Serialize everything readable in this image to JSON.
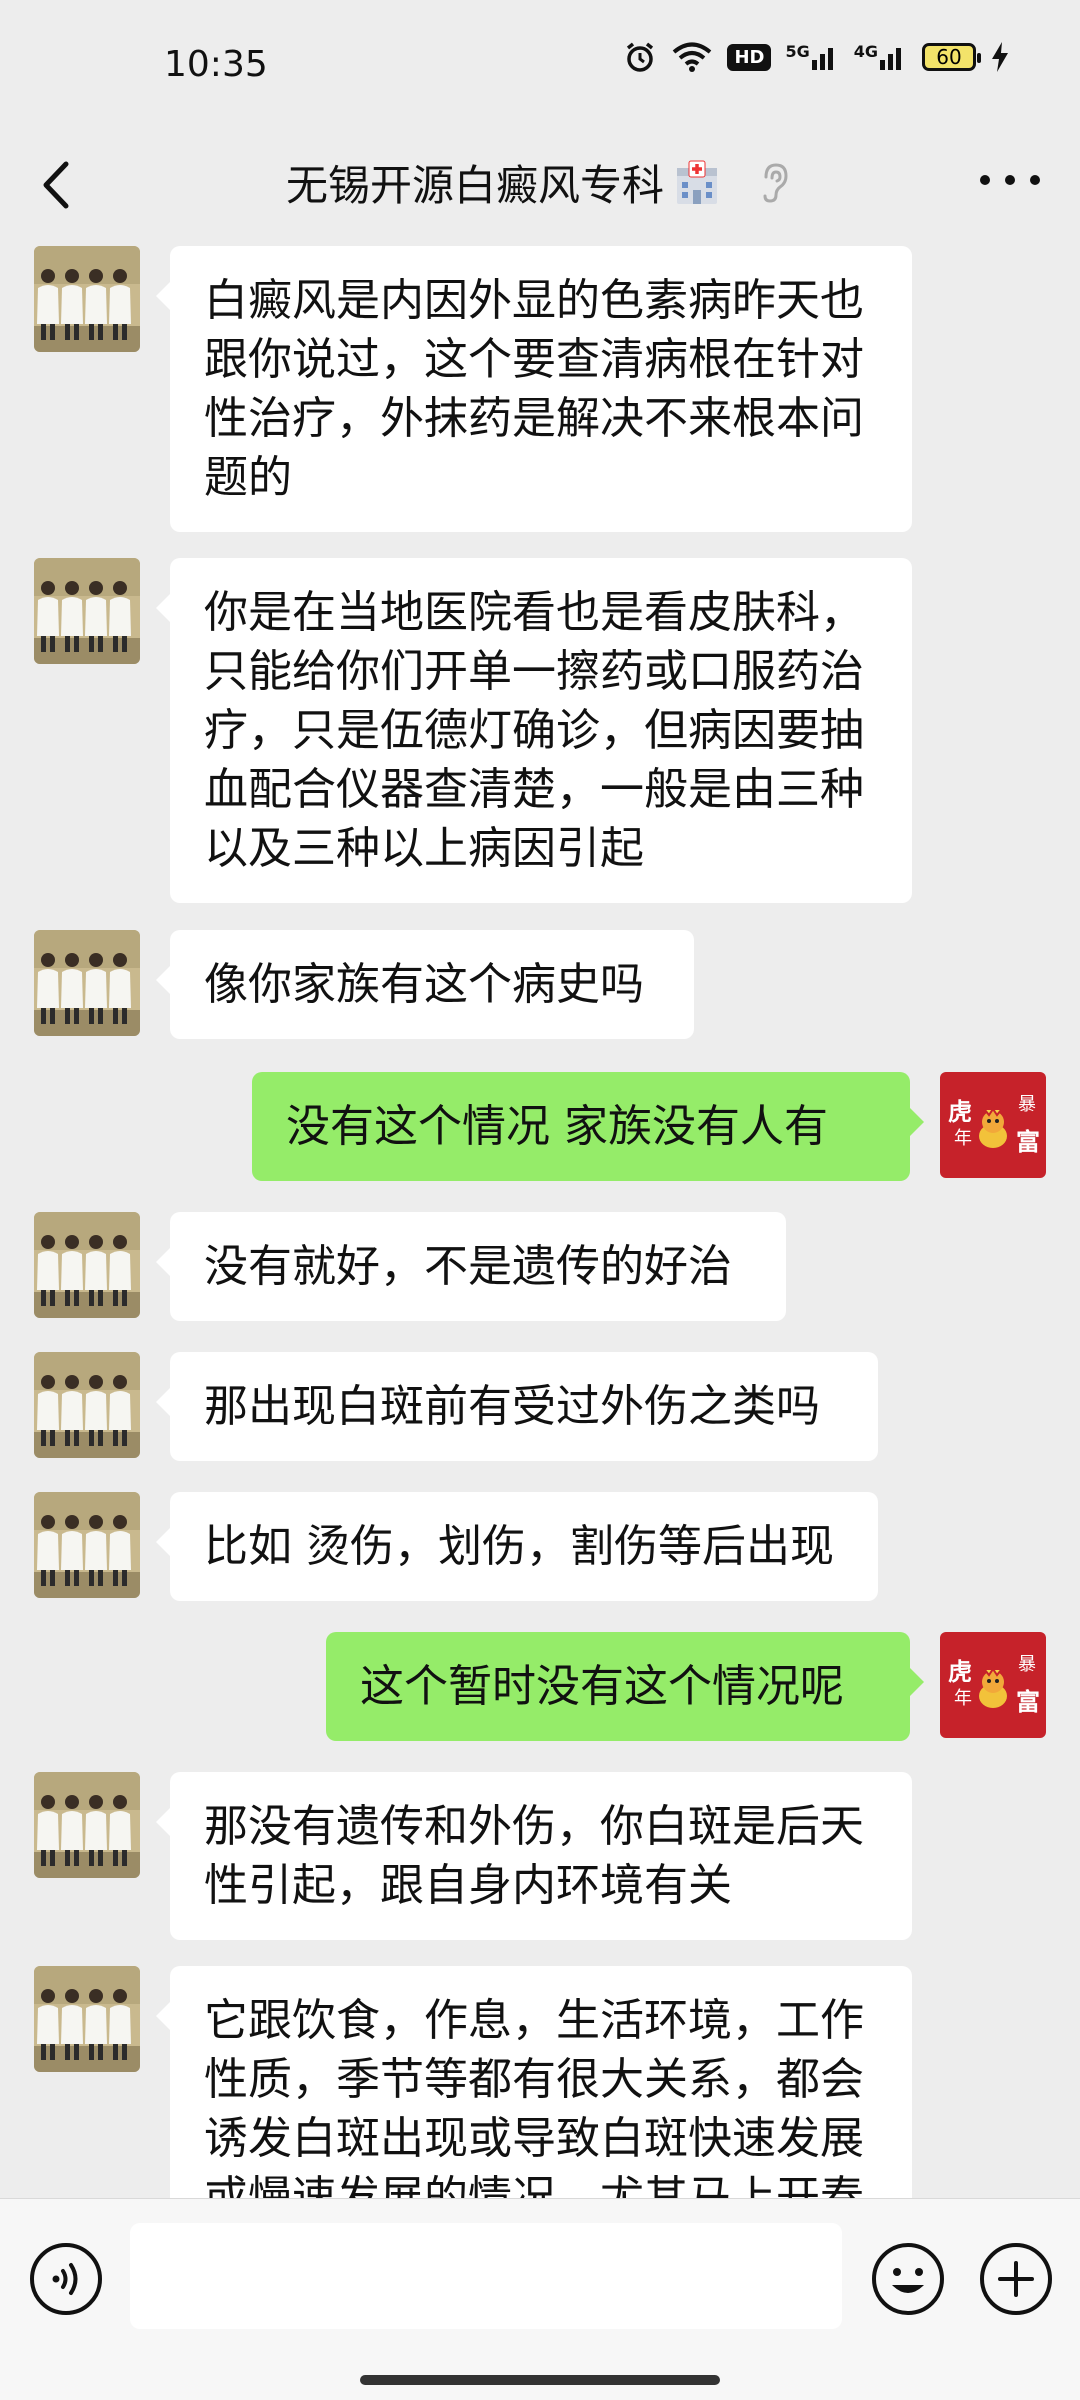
{
  "status_bar": {
    "time": "10:35",
    "hd_label": "HD",
    "net1_label": "5G",
    "net2_label": "4G",
    "battery_level": "60"
  },
  "header": {
    "title": "无锡开源白癜风专科",
    "title_emoji": "hospital-icon"
  },
  "messages": [
    {
      "side": "in",
      "text": "白癜风是内因外显的色素病昨天也跟你说过，这个要查清病根在针对性治疗，外抹药是解决不来根本问题的"
    },
    {
      "side": "in",
      "text": "你是在当地医院看也是看皮肤科，只能给你们开单一擦药或口服药治疗，只是伍德灯确诊，但病因要抽血配合仪器查清楚，一般是由三种以及三种以上病因引起"
    },
    {
      "side": "in",
      "text": "像你家族有这个病史吗"
    },
    {
      "side": "out",
      "text": "没有这个情况   家族没有人有"
    },
    {
      "side": "in",
      "text": "没有就好，不是遗传的好治"
    },
    {
      "side": "in",
      "text": "那出现白斑前有受过外伤之类吗"
    },
    {
      "side": "in",
      "text": "比如 烫伤，划伤，割伤等后出现"
    },
    {
      "side": "out",
      "text": "这个暂时没有这个情况呢"
    },
    {
      "side": "in",
      "text": "那没有遗传和外伤，你白斑是后天性引起，跟自身内环境有关"
    },
    {
      "side": "in",
      "text": "它跟饮食，作息，生活环境，工作性质，季节等都有很大关系，都会诱发白斑出现或导致白斑快速发展或慢速发展的情况，尤其马上开春"
    }
  ],
  "my_avatar": {
    "line1": "虎",
    "line2": "年",
    "line3": "暴",
    "line4": "富"
  },
  "input": {
    "placeholder": ""
  }
}
